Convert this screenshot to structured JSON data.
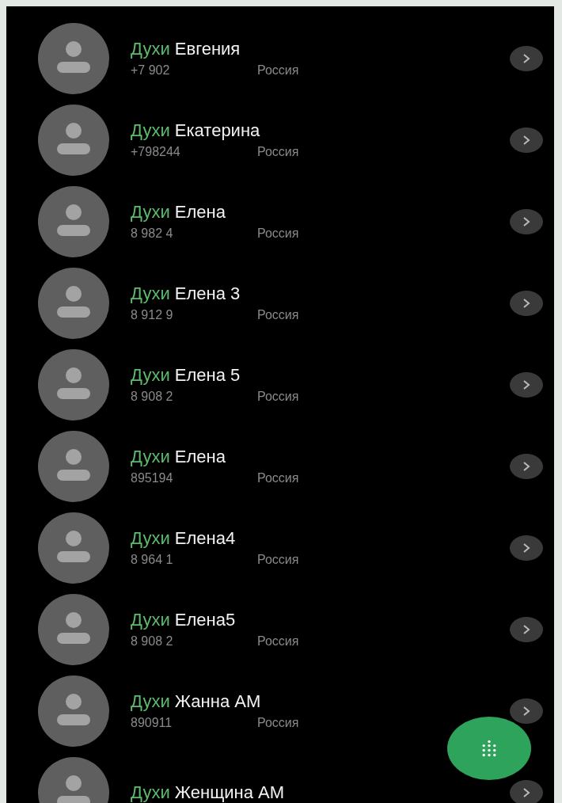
{
  "contacts": [
    {
      "prefix": "Духи",
      "name": "Евгения",
      "number": "+7 902",
      "country": "Россия"
    },
    {
      "prefix": "Духи",
      "name": "Екатерина",
      "number": "+798244",
      "country": "Россия"
    },
    {
      "prefix": "Духи",
      "name": "Елена",
      "number": "8 982 4",
      "country": "Россия"
    },
    {
      "prefix": "Духи",
      "name": "Елена 3",
      "number": "8 912 9",
      "country": "Россия"
    },
    {
      "prefix": "Духи",
      "name": "Елена 5",
      "number": "8 908 2",
      "country": "Россия"
    },
    {
      "prefix": "Духи",
      "name": "Елена",
      "number": "895194",
      "country": "Россия"
    },
    {
      "prefix": "Духи",
      "name": "Елена4",
      "number": "8 964 1",
      "country": "Россия"
    },
    {
      "prefix": "Духи",
      "name": "Елена5",
      "number": "8 908 2",
      "country": "Россия"
    },
    {
      "prefix": "Духи",
      "name": "Жанна АМ",
      "number": "890911",
      "country": "Россия"
    },
    {
      "prefix": "Духи",
      "name": "Женщина АМ"
    }
  ]
}
